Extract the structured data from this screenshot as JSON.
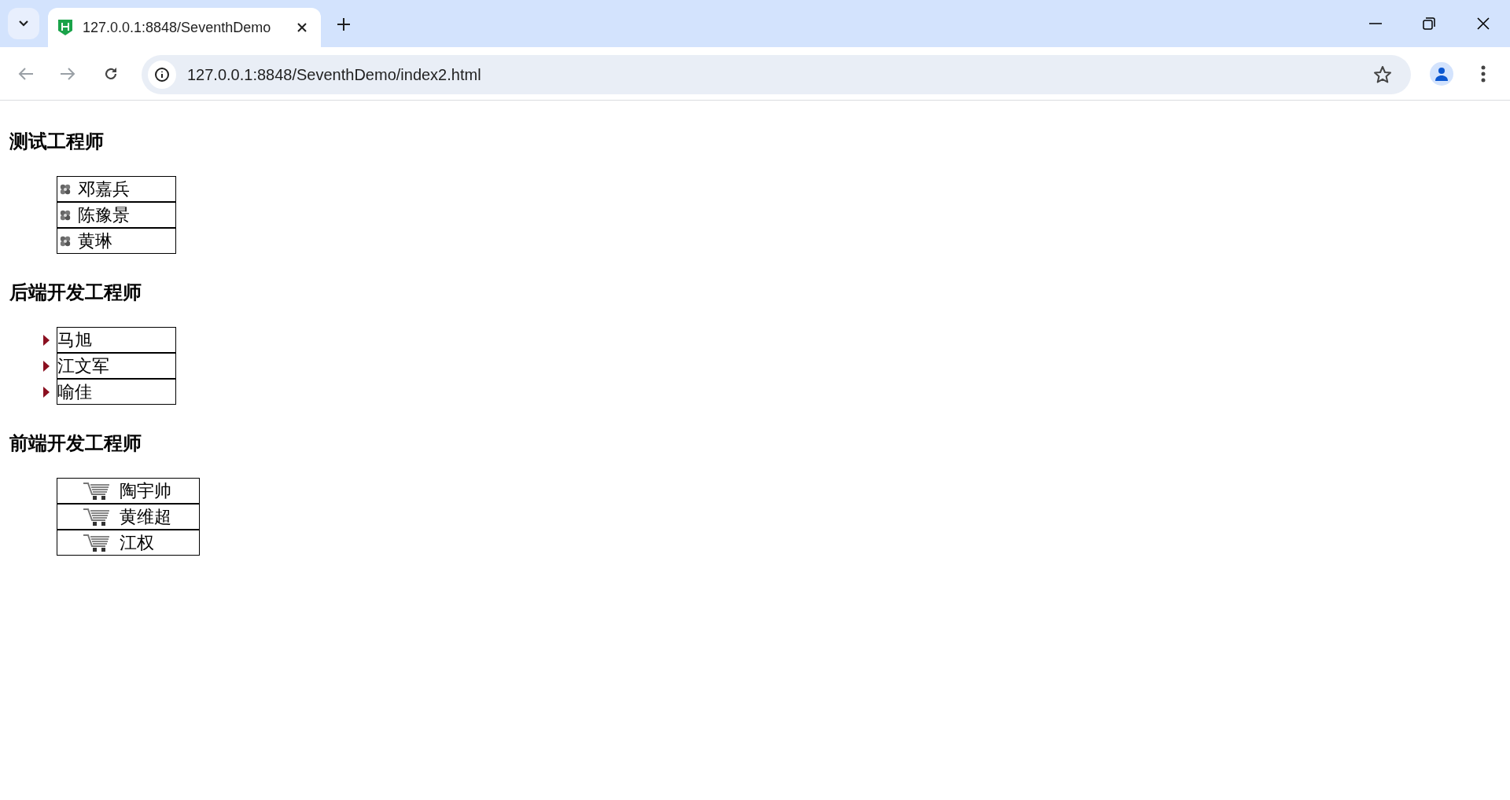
{
  "browser": {
    "tab": {
      "title": "127.0.0.1:8848/SeventhDemo",
      "selected": true
    },
    "address": "127.0.0.1:8848/SeventhDemo/index2.html"
  },
  "sections": [
    {
      "heading": "测试工程师",
      "kind": "flower",
      "items": [
        "邓嘉兵",
        "陈豫景",
        "黄琳"
      ]
    },
    {
      "heading": "后端开发工程师",
      "kind": "triangle",
      "items": [
        "马旭",
        "江文军",
        "喻佳"
      ]
    },
    {
      "heading": "前端开发工程师",
      "kind": "cart",
      "items": [
        "陶宇帅",
        "黄维超",
        "江权"
      ]
    }
  ]
}
